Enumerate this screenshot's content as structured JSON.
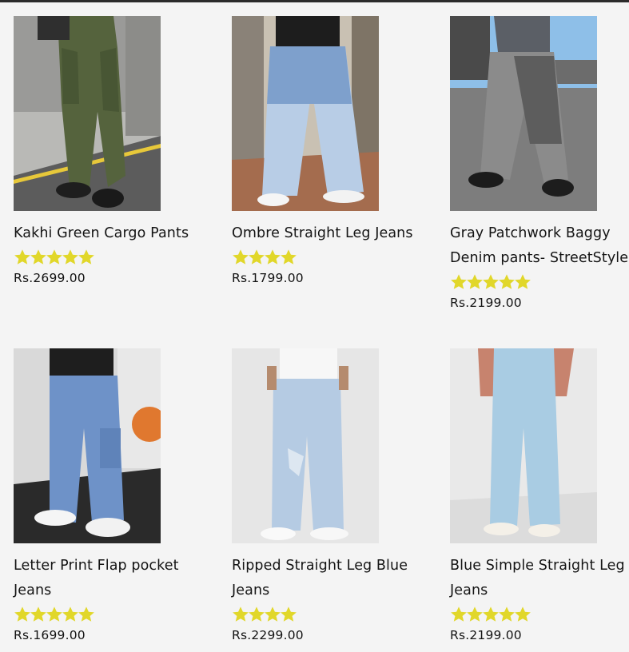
{
  "colors": {
    "star": "#e1d72a",
    "background": "#f4f4f4",
    "text": "#141414"
  },
  "products": [
    {
      "name": "Kakhi Green Cargo Pants",
      "rating": 5,
      "price": "Rs.2699.00",
      "image_desc": "green-cargo-pants-photo"
    },
    {
      "name": "Ombre Straight Leg Jeans",
      "rating": 4,
      "price": "Rs.1799.00",
      "image_desc": "ombre-jeans-photo"
    },
    {
      "name": "Gray Patchwork Baggy Denim pants- StreetStyle",
      "rating": 5,
      "price": "Rs.2199.00",
      "image_desc": "gray-patchwork-pants-photo"
    },
    {
      "name": "Letter Print Flap pocket Jeans",
      "rating": 5,
      "price": "Rs.1699.00",
      "image_desc": "flap-pocket-jeans-photo"
    },
    {
      "name": "Ripped Straight Leg Blue Jeans",
      "rating": 4,
      "price": "Rs.2299.00",
      "image_desc": "ripped-jeans-photo"
    },
    {
      "name": "Blue Simple Straight Leg Jeans",
      "rating": 5,
      "price": "Rs.2199.00",
      "image_desc": "simple-straight-jeans-photo"
    }
  ]
}
